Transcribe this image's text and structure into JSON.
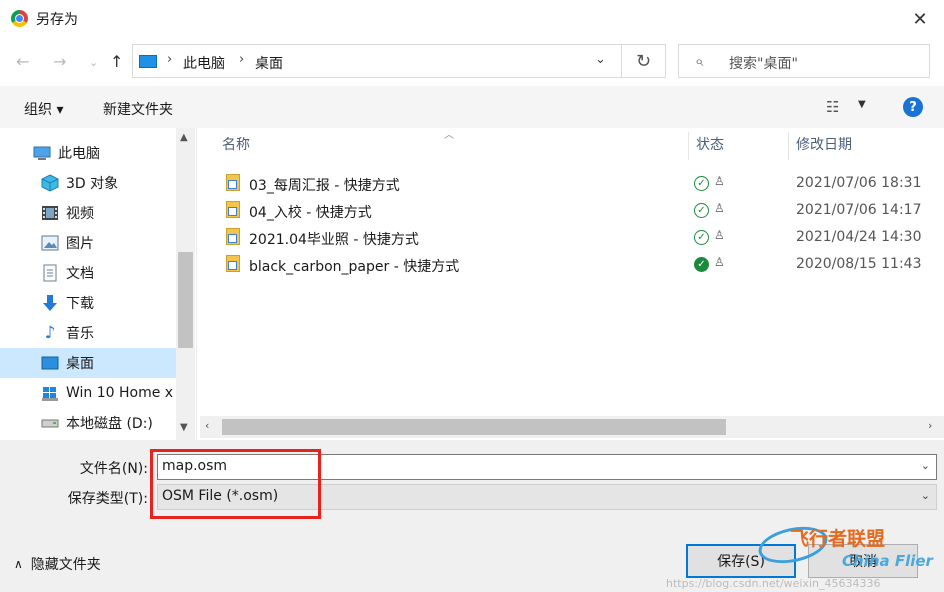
{
  "window": {
    "title": "另存为"
  },
  "address": {
    "segments": [
      "此电脑",
      "桌面"
    ]
  },
  "search": {
    "placeholder": "搜索\"桌面\""
  },
  "toolbar": {
    "organize": "组织 ▾",
    "new_folder": "新建文件夹"
  },
  "sidebar": {
    "items": [
      {
        "label": "此电脑",
        "icon": "computer-icon",
        "root": true
      },
      {
        "label": "3D 对象",
        "icon": "cube-icon"
      },
      {
        "label": "视频",
        "icon": "video-icon"
      },
      {
        "label": "图片",
        "icon": "picture-icon"
      },
      {
        "label": "文档",
        "icon": "document-icon"
      },
      {
        "label": "下载",
        "icon": "download-icon"
      },
      {
        "label": "音乐",
        "icon": "music-icon"
      },
      {
        "label": "桌面",
        "icon": "desktop-icon",
        "selected": true
      },
      {
        "label": "Win 10 Home x",
        "icon": "windows-drive-icon"
      },
      {
        "label": "本地磁盘 (D:)",
        "icon": "disk-icon"
      }
    ]
  },
  "columns": {
    "name": "名称",
    "status": "状态",
    "modified": "修改日期"
  },
  "files": [
    {
      "name": "03_每周汇报 - 快捷方式",
      "date": "2021/07/06 18:31",
      "status": "available"
    },
    {
      "name": "04_入校 - 快捷方式",
      "date": "2021/07/06 14:17",
      "status": "available"
    },
    {
      "name": "2021.04毕业照 - 快捷方式",
      "date": "2021/04/24 14:30",
      "status": "available"
    },
    {
      "name": "black_carbon_paper - 快捷方式",
      "date": "2020/08/15 11:43",
      "status": "synced"
    }
  ],
  "form": {
    "filename_label": "文件名(N):",
    "filename_value": "map.osm",
    "filetype_label": "保存类型(T):",
    "filetype_value": "OSM File (*.osm)"
  },
  "footer": {
    "hide_folders": "隐藏文件夹",
    "save_button": "保存(S)",
    "cancel_button": "取消"
  },
  "watermark": {
    "url": "https://blog.csdn.net/weixin_45634336",
    "logo_cn": "飞行者联盟",
    "logo_en": "China Flier"
  },
  "colors": {
    "selection": "#cce8ff",
    "accent": "#0078d7",
    "highlight": "#e8231e"
  }
}
